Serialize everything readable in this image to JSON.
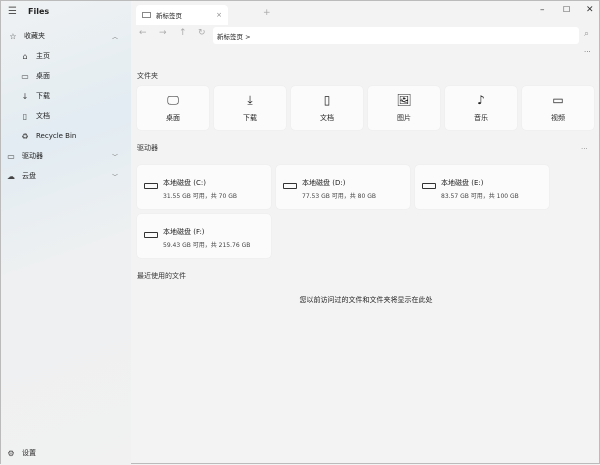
{
  "app": {
    "title": "Files"
  },
  "sidebar": {
    "favorites": "收藏夹",
    "items": [
      {
        "label": "主页",
        "icon": "home-icon"
      },
      {
        "label": "桌面",
        "icon": "desktop-icon"
      },
      {
        "label": "下载",
        "icon": "download-icon"
      },
      {
        "label": "文档",
        "icon": "document-icon"
      },
      {
        "label": "Recycle Bin",
        "icon": "recycle-bin-icon"
      }
    ],
    "drives": "驱动器",
    "cloud": "云盘",
    "settings": "设置"
  },
  "tab": {
    "label": "新标签页",
    "close": "×",
    "new": "+"
  },
  "address": {
    "path": "新标签页 >"
  },
  "sections": {
    "folders": "文件夹",
    "drives": "驱动器",
    "recent": "最近使用的文件",
    "recent_empty": "您以前访问过的文件和文件夹将显示在此处"
  },
  "folders": [
    {
      "label": "桌面"
    },
    {
      "label": "下载"
    },
    {
      "label": "文档"
    },
    {
      "label": "图片"
    },
    {
      "label": "音乐"
    },
    {
      "label": "视频"
    }
  ],
  "drives": [
    {
      "name": "本地磁盘 (C:)",
      "space": "31.55 GB 可用，共 70 GB"
    },
    {
      "name": "本地磁盘 (D:)",
      "space": "77.53 GB 可用，共 80 GB"
    },
    {
      "name": "本地磁盘 (E:)",
      "space": "83.57 GB 可用，共 100 GB"
    },
    {
      "name": "本地磁盘 (F:)",
      "space": "59.43 GB 可用，共 215.76 GB"
    }
  ]
}
